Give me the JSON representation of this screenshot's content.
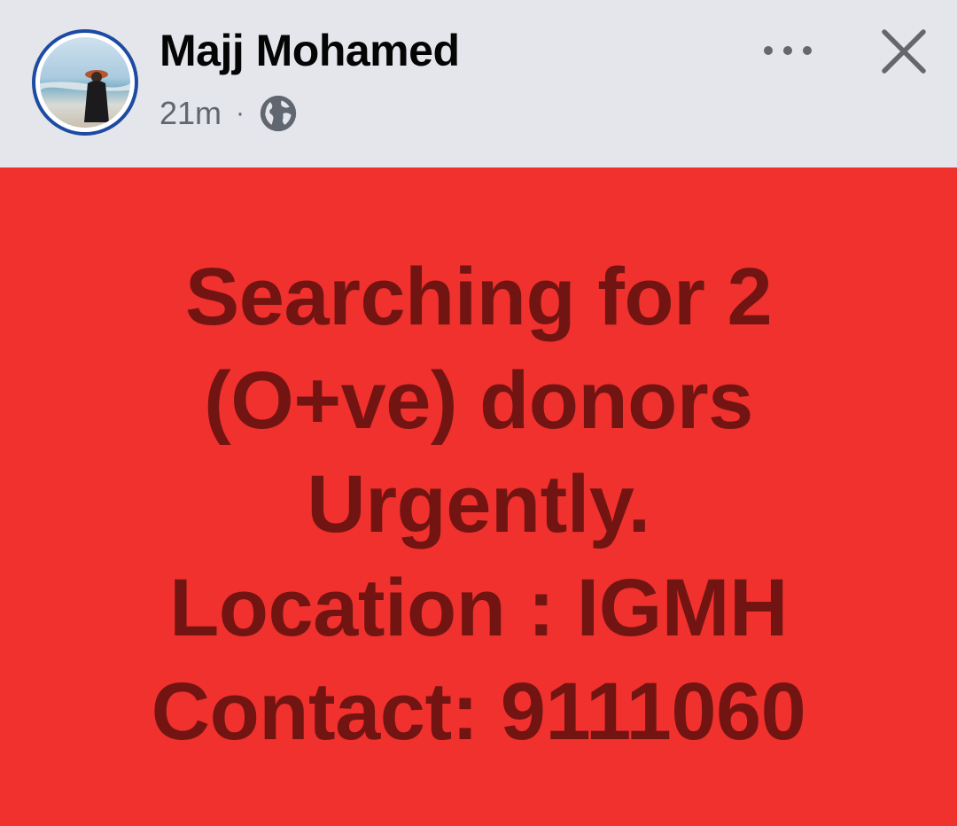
{
  "post": {
    "author": "Majj Mohamed",
    "time": "21m",
    "separator": "·",
    "audience_icon": "globe-icon",
    "more_icon": "more-options-icon",
    "close_icon": "close-icon",
    "avatar_ring_color": "#1d4ba3",
    "background_color": "#f0312e",
    "text_color": "#721512",
    "message_lines": [
      "Searching for 2",
      "(O+ve) donors",
      "Urgently.",
      "Location : IGMH",
      "Contact: 9111060"
    ]
  }
}
